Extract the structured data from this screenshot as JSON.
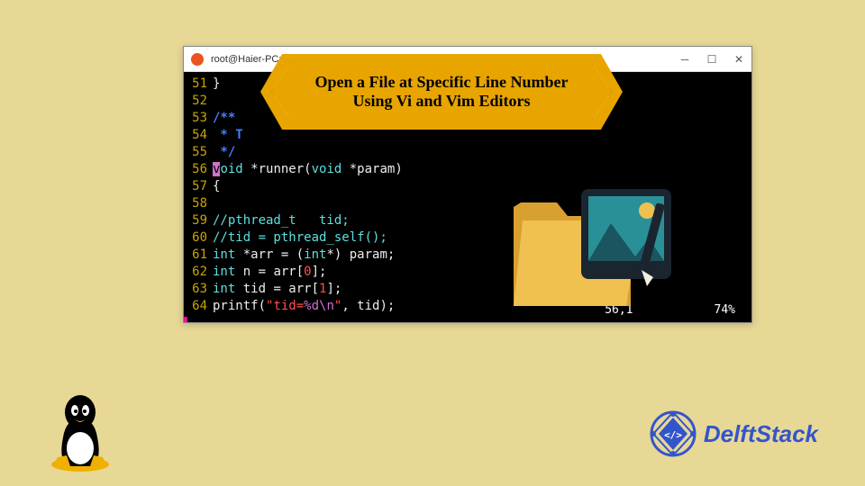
{
  "window": {
    "title": "root@Haier-PC: /mnt/e"
  },
  "banner": {
    "line1": "Open a File at Specific Line Number",
    "line2": "Using Vi and Vim Editors"
  },
  "code": {
    "lines": [
      {
        "num": "51",
        "segments": [
          {
            "text": "}",
            "cls": "c-white"
          }
        ]
      },
      {
        "num": "52",
        "segments": []
      },
      {
        "num": "53",
        "segments": [
          {
            "text": "/**",
            "cls": "c-comment-blue"
          }
        ]
      },
      {
        "num": "54",
        "segments": [
          {
            "text": " * T",
            "cls": "c-comment-blue"
          }
        ]
      },
      {
        "num": "55",
        "segments": [
          {
            "text": " */",
            "cls": "c-comment-blue"
          }
        ]
      },
      {
        "num": "56",
        "segments": [
          {
            "text": "v",
            "cls": "cursor-block"
          },
          {
            "text": "oid",
            "cls": "c-cyan"
          },
          {
            "text": " *runner(",
            "cls": "c-white"
          },
          {
            "text": "void",
            "cls": "c-cyan"
          },
          {
            "text": " *param)",
            "cls": "c-white"
          }
        ]
      },
      {
        "num": "57",
        "segments": [
          {
            "text": "{",
            "cls": "c-white"
          }
        ]
      },
      {
        "num": "58",
        "segments": []
      },
      {
        "num": "59",
        "segments": [
          {
            "text": "//pthread_t   tid;",
            "cls": "c-cyan"
          }
        ]
      },
      {
        "num": "60",
        "segments": [
          {
            "text": "//tid = pthread_self();",
            "cls": "c-cyan"
          }
        ]
      },
      {
        "num": "61",
        "segments": [
          {
            "text": "int",
            "cls": "c-cyan"
          },
          {
            "text": " *arr = (",
            "cls": "c-white"
          },
          {
            "text": "int",
            "cls": "c-cyan"
          },
          {
            "text": "*) param;",
            "cls": "c-white"
          }
        ]
      },
      {
        "num": "62",
        "segments": [
          {
            "text": "int",
            "cls": "c-cyan"
          },
          {
            "text": " n = arr[",
            "cls": "c-white"
          },
          {
            "text": "0",
            "cls": "c-red"
          },
          {
            "text": "];",
            "cls": "c-white"
          }
        ]
      },
      {
        "num": "63",
        "segments": [
          {
            "text": "int",
            "cls": "c-cyan"
          },
          {
            "text": " tid = arr[",
            "cls": "c-white"
          },
          {
            "text": "1",
            "cls": "c-red"
          },
          {
            "text": "];",
            "cls": "c-white"
          }
        ]
      },
      {
        "num": "64",
        "segments": [
          {
            "text": "printf(",
            "cls": "c-white"
          },
          {
            "text": "\"tid=",
            "cls": "c-red"
          },
          {
            "text": "%d",
            "cls": "c-magenta"
          },
          {
            "text": "\\n",
            "cls": "c-magenta"
          },
          {
            "text": "\"",
            "cls": "c-red"
          },
          {
            "text": ", tid);",
            "cls": "c-white"
          }
        ]
      }
    ]
  },
  "status": {
    "position": "56,1",
    "percent": "74%"
  },
  "logos": {
    "delft": "DelftStack"
  }
}
